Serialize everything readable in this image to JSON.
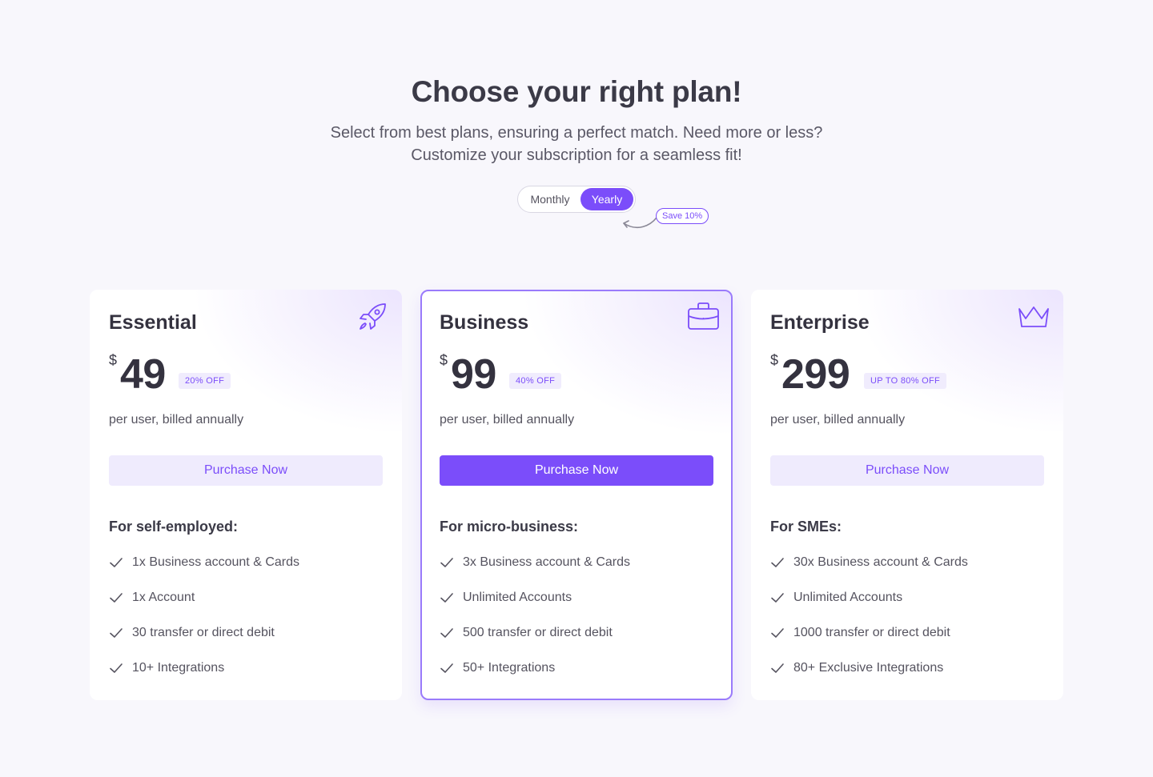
{
  "header": {
    "title": "Choose your right plan!",
    "subtitle_line1": "Select from best plans, ensuring a perfect match. Need more or less?",
    "subtitle_line2": "Customize your subscription for a seamless fit!"
  },
  "billing_toggle": {
    "monthly_label": "Monthly",
    "yearly_label": "Yearly",
    "selected": "Yearly",
    "save_badge": "Save 10%"
  },
  "colors": {
    "accent": "#7b4dfa",
    "accent_light": "#efebfd",
    "background": "#f8f7fc"
  },
  "plans": [
    {
      "name": "Essential",
      "icon": "rocket-icon",
      "currency": "$",
      "price": "49",
      "discount": "20% OFF",
      "billing": "per user, billed annually",
      "cta": "Purchase Now",
      "features_title": "For self-employed:",
      "features": [
        "1x Business account & Cards",
        "1x Account",
        "30 transfer or direct debit",
        "10+ Integrations"
      ]
    },
    {
      "name": "Business",
      "icon": "briefcase-icon",
      "currency": "$",
      "price": "99",
      "discount": "40% OFF",
      "billing": "per user, billed annually",
      "cta": "Purchase Now",
      "features_title": "For micro-business:",
      "features": [
        "3x Business account & Cards",
        "Unlimited Accounts",
        "500 transfer or direct debit",
        "50+ Integrations"
      ]
    },
    {
      "name": "Enterprise",
      "icon": "crown-icon",
      "currency": "$",
      "price": "299",
      "discount": "UP TO 80% OFF",
      "billing": "per user, billed annually",
      "cta": "Purchase Now",
      "features_title": "For SMEs:",
      "features": [
        "30x Business account & Cards",
        "Unlimited Accounts",
        "1000 transfer or direct debit",
        "80+ Exclusive Integrations"
      ]
    }
  ]
}
